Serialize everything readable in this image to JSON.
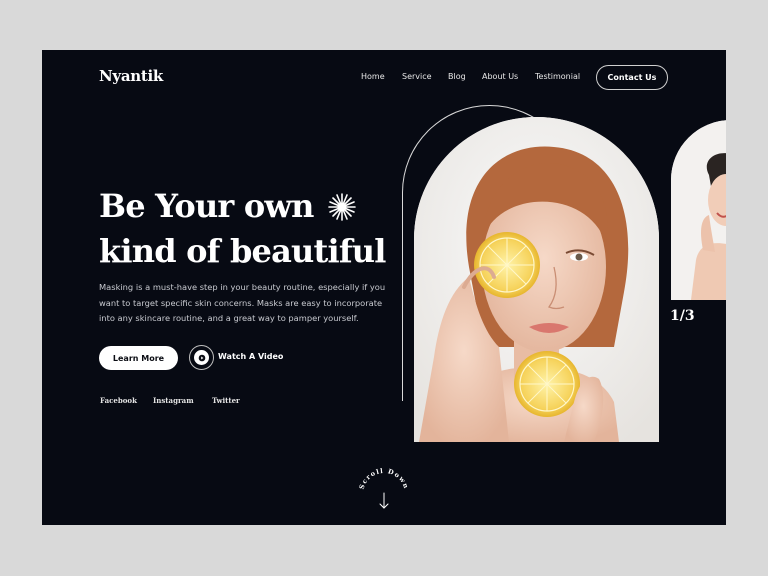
{
  "brand": {
    "logo": "Nyantik"
  },
  "nav": {
    "items": [
      {
        "label": "Home"
      },
      {
        "label": "Service"
      },
      {
        "label": "Blog"
      },
      {
        "label": "About Us"
      },
      {
        "label": "Testimonial"
      }
    ],
    "cta_label": "Contact Us"
  },
  "hero": {
    "headline_line1": "Be Your own",
    "headline_line2": "kind of beautiful",
    "description": "Masking is a must-have step in your beauty routine, especially if you want to target specific skin concerns. Masks are easy to incorporate into any skincare routine, and a great way to pamper yourself.",
    "primary_button": "Learn More",
    "video_button": "Watch A Video"
  },
  "social": [
    {
      "label": "Facebook"
    },
    {
      "label": "Instagram"
    },
    {
      "label": "Twitter"
    }
  ],
  "slider": {
    "indicator": "1/3"
  },
  "scroll": {
    "label": "Scroll Down"
  },
  "colors": {
    "background": "#070a13",
    "page": "#d9d9d9",
    "text": "#ffffff",
    "accent_lemon": "#f6d35c"
  },
  "icons": [
    "sparkle-icon",
    "play-icon",
    "arrow-down-icon"
  ]
}
